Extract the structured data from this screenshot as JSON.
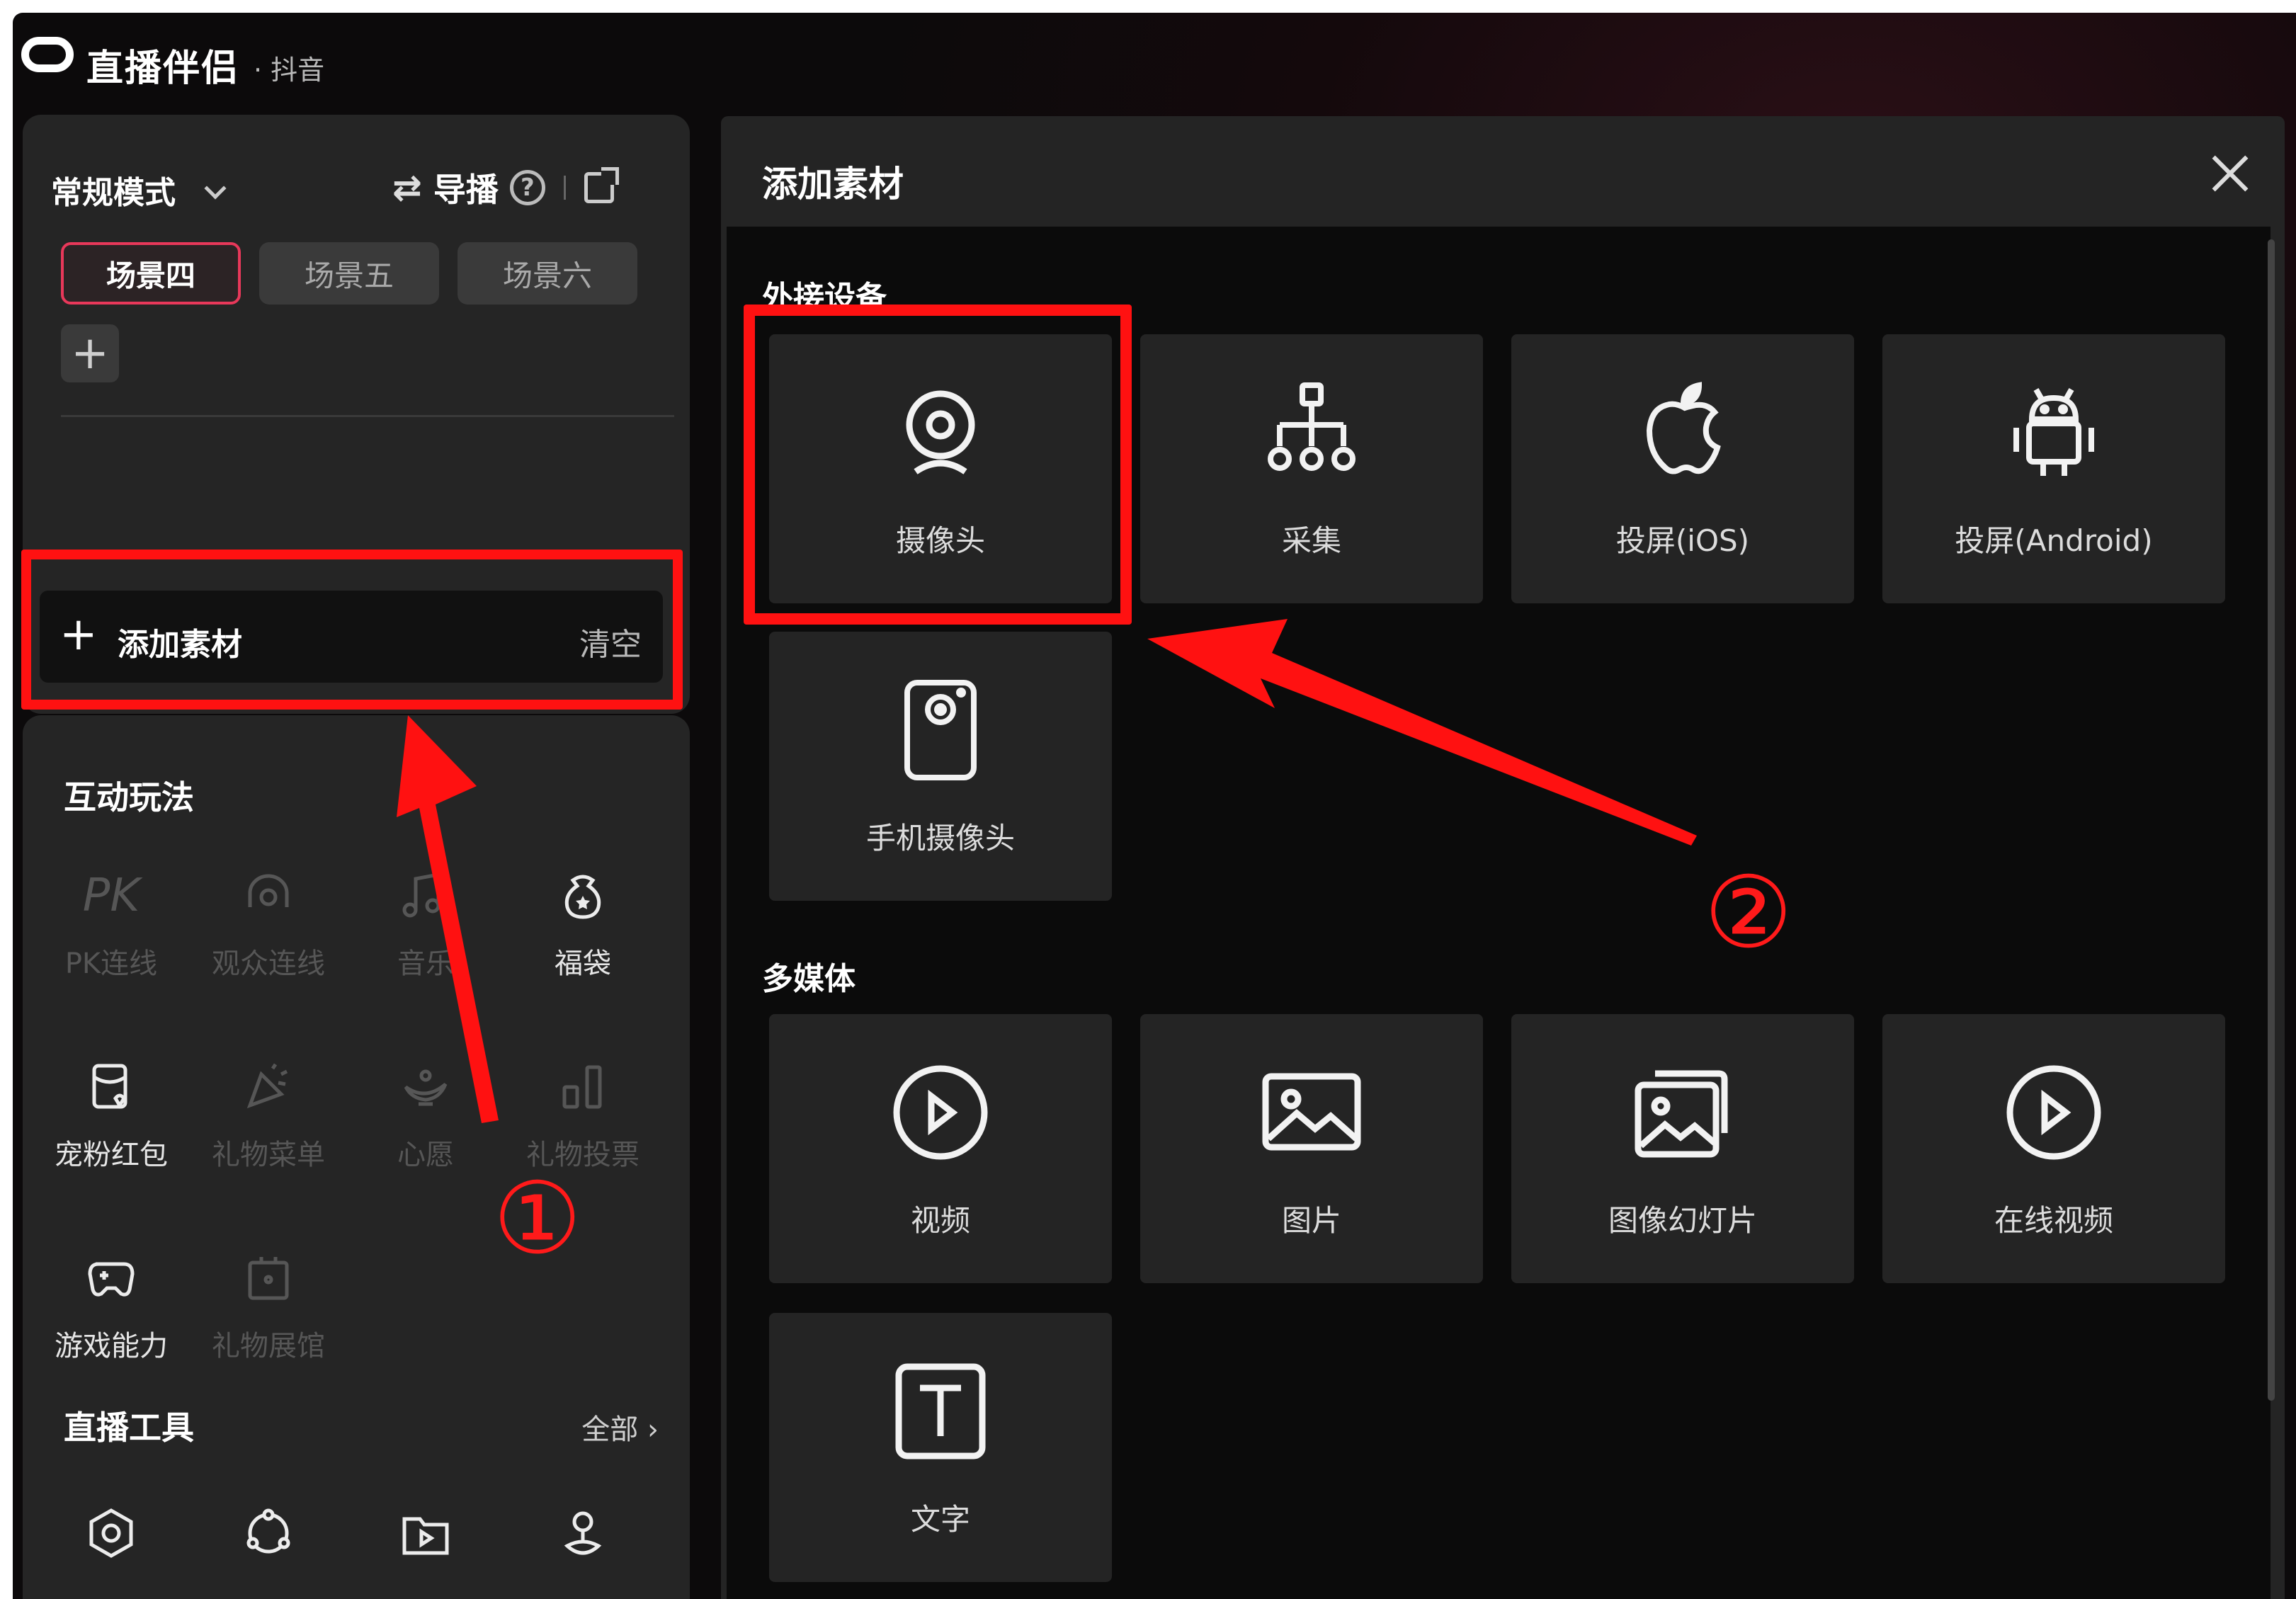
{
  "titlebar": {
    "app_name": "直播伴侣",
    "app_sub": "· 抖音"
  },
  "left_panel": {
    "mode_label": "常规模式",
    "guide_label": "导播",
    "scenes": [
      "场景四",
      "场景五",
      "场景六"
    ],
    "add_material_label": "添加素材",
    "clear_label": "清空"
  },
  "interactive": {
    "title": "互动玩法",
    "items": [
      {
        "label": "PK连线",
        "icon": "pk-icon",
        "enabled": false
      },
      {
        "label": "观众连线",
        "icon": "audience-link-icon",
        "enabled": false
      },
      {
        "label": "音乐",
        "icon": "music-icon",
        "enabled": false
      },
      {
        "label": "福袋",
        "icon": "lucky-bag-icon",
        "enabled": true
      },
      {
        "label": "宠粉红包",
        "icon": "red-packet-icon",
        "enabled": true
      },
      {
        "label": "礼物菜单",
        "icon": "gift-menu-icon",
        "enabled": false
      },
      {
        "label": "心愿",
        "icon": "wish-lamp-icon",
        "enabled": false
      },
      {
        "label": "礼物投票",
        "icon": "gift-vote-icon",
        "enabled": false
      },
      {
        "label": "游戏能力",
        "icon": "gamepad-icon",
        "enabled": true
      },
      {
        "label": "礼物展馆",
        "icon": "gift-gallery-icon",
        "enabled": false
      }
    ]
  },
  "live_tools": {
    "title": "直播工具",
    "all_label": "全部"
  },
  "dialog": {
    "title": "添加素材",
    "sections": [
      {
        "title": "外接设备",
        "items": [
          {
            "label": "摄像头",
            "icon": "webcam-icon"
          },
          {
            "label": "采集",
            "icon": "capture-tree-icon"
          },
          {
            "label": "投屏(iOS)",
            "icon": "apple-icon"
          },
          {
            "label": "投屏(Android)",
            "icon": "android-icon"
          },
          {
            "label": "手机摄像头",
            "icon": "phone-camera-icon"
          }
        ]
      },
      {
        "title": "多媒体",
        "items": [
          {
            "label": "视频",
            "icon": "video-play-icon"
          },
          {
            "label": "图片",
            "icon": "image-icon"
          },
          {
            "label": "图像幻灯片",
            "icon": "slideshow-icon"
          },
          {
            "label": "在线视频",
            "icon": "online-video-icon"
          },
          {
            "label": "文字",
            "icon": "text-icon"
          }
        ]
      }
    ]
  },
  "annotations": {
    "step1": "①",
    "step2": "②",
    "color": "#ff1111"
  },
  "colors": {
    "accent": "#e8385a",
    "annotation_red": "#ff1111"
  }
}
